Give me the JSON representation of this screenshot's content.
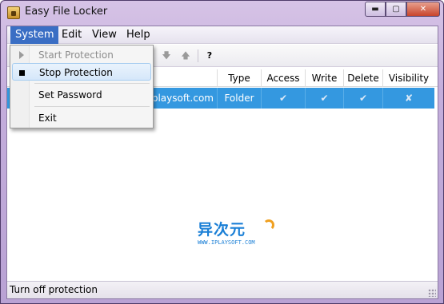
{
  "window": {
    "title": "Easy File Locker"
  },
  "menubar": {
    "items": [
      "System",
      "Edit",
      "View",
      "Help"
    ]
  },
  "system_menu": {
    "items": [
      {
        "label": "Start Protection",
        "state": "disabled",
        "icon": "play-icon"
      },
      {
        "label": "Stop Protection",
        "state": "highlighted",
        "icon": "stop-icon"
      },
      {
        "label": "Set Password",
        "state": "normal"
      },
      {
        "label": "Exit",
        "state": "normal"
      }
    ]
  },
  "toolbar": {
    "help_label": "?"
  },
  "table": {
    "columns": [
      "Type",
      "Access",
      "Write",
      "Delete",
      "Visibility"
    ],
    "rows": [
      {
        "path": "playsoft.com",
        "type": "Folder",
        "access": "✔",
        "write": "✔",
        "delete": "✔",
        "visibility": "✘"
      }
    ]
  },
  "watermark": {
    "logo": "异次元",
    "url": "WWW.IPLAYSOFT.COM"
  },
  "statusbar": {
    "text": "Turn off protection"
  },
  "colors": {
    "selection": "#3498e0",
    "menu_active": "#3a6ec4",
    "watermark": "#1a7fd6"
  }
}
